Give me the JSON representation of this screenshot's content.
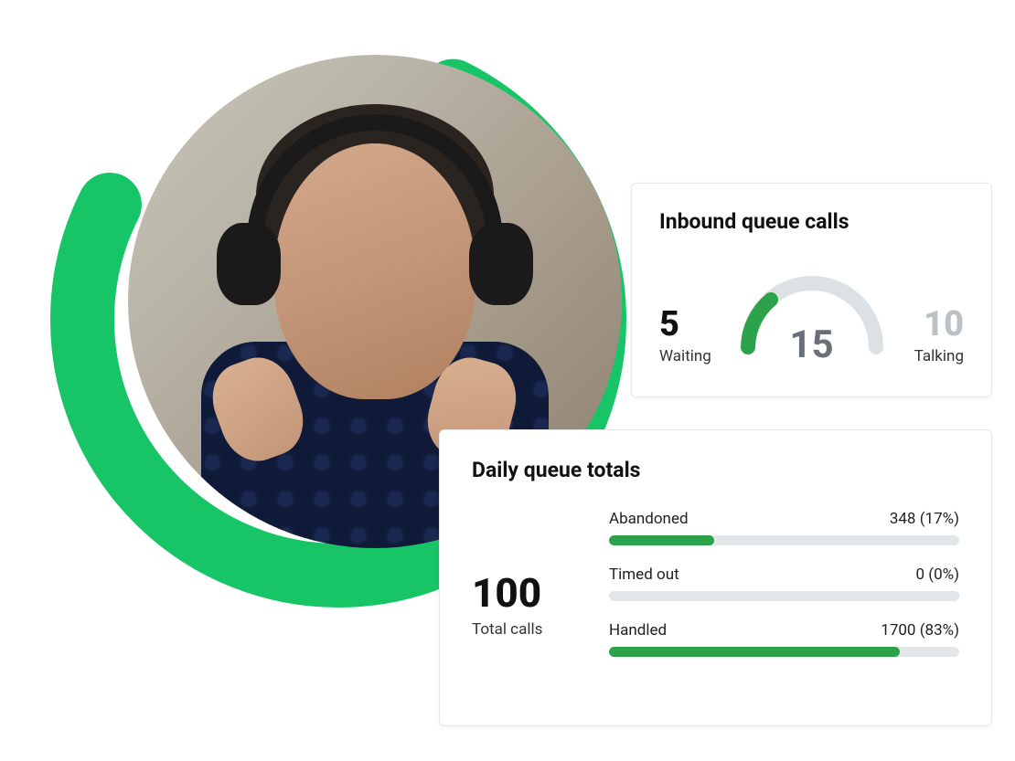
{
  "colors": {
    "accent_green": "#17c566",
    "bar_green": "#2ca24a",
    "track_gray": "#e2e6e9",
    "gauge_gray": "#dbe1e4"
  },
  "inbound": {
    "title": "Inbound queue calls",
    "waiting": {
      "value": "5",
      "label": "Waiting"
    },
    "talking": {
      "value": "10",
      "label": "Talking"
    },
    "total": "15",
    "gauge_percent": 33
  },
  "daily": {
    "title": "Daily queue totals",
    "total_number": "100",
    "total_label": "Total calls",
    "rows": [
      {
        "label": "Abandoned",
        "value": "348 (17%)",
        "percent": 30
      },
      {
        "label": "Timed out",
        "value": "0 (0%)",
        "percent": 0
      },
      {
        "label": "Handled",
        "value": "1700 (83%)",
        "percent": 83
      }
    ]
  },
  "chart_data": [
    {
      "type": "bar",
      "title": "Daily queue totals",
      "orientation": "horizontal",
      "categories": [
        "Abandoned",
        "Timed out",
        "Handled"
      ],
      "values": [
        348,
        0,
        1700
      ],
      "percentages": [
        17,
        0,
        83
      ],
      "total_calls": 100,
      "xlabel": "",
      "ylabel": ""
    },
    {
      "type": "gauge",
      "title": "Inbound queue calls",
      "segments": [
        {
          "name": "Waiting",
          "value": 5
        },
        {
          "name": "Talking",
          "value": 10
        }
      ],
      "total": 15
    }
  ]
}
